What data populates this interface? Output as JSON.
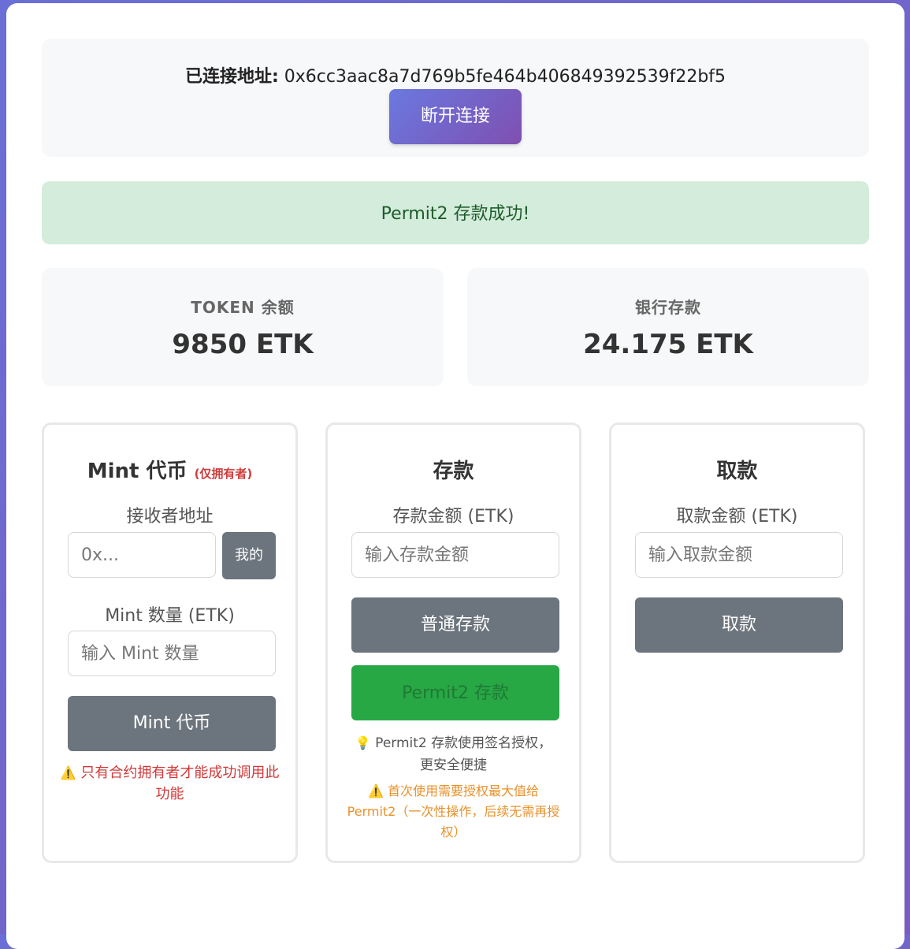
{
  "connection": {
    "label": "已连接地址:",
    "address": "0x6cc3aac8a7d769b5fe464b406849392539f22bf5",
    "disconnect_label": "断开连接"
  },
  "status_message": "Permit2 存款成功!",
  "balances": {
    "token_title": "TOKEN 余额",
    "token_value": "9850 ETK",
    "bank_title": "银行存款",
    "bank_value": "24.175 ETK"
  },
  "mint": {
    "title": "Mint 代币",
    "owner_tag": "(仅拥有者)",
    "recipient_label": "接收者地址",
    "recipient_placeholder": "0x...",
    "mine_button": "我的",
    "amount_label": "Mint 数量 (ETK)",
    "amount_placeholder": "输入 Mint 数量",
    "submit_label": "Mint 代币",
    "warning_icon": "warning-icon",
    "warning_text": "只有合约拥有者才能成功调用此功能"
  },
  "deposit": {
    "title": "存款",
    "amount_label": "存款金额 (ETK)",
    "amount_placeholder": "输入存款金额",
    "normal_button": "普通存款",
    "permit2_button": "Permit2 存款",
    "tip_icon": "lightbulb-icon",
    "tip_text": "Permit2 存款使用签名授权，更安全便捷",
    "warning_icon": "warning-icon",
    "warning_text": "首次使用需要授权最大值给 Permit2（一次性操作，后续无需再授权）"
  },
  "withdraw": {
    "title": "取款",
    "amount_label": "取款金额 (ETK)",
    "amount_placeholder": "输入取款金额",
    "submit_label": "取款"
  },
  "colors": {
    "accent_gradient_start": "#6a79e0",
    "accent_gradient_end": "#7f4fb0",
    "success_bg": "#d4ecdb",
    "button_gray": "#6c757d",
    "button_green": "#28a745",
    "warning_red": "#d03a3a",
    "warning_orange": "#e8912b"
  }
}
